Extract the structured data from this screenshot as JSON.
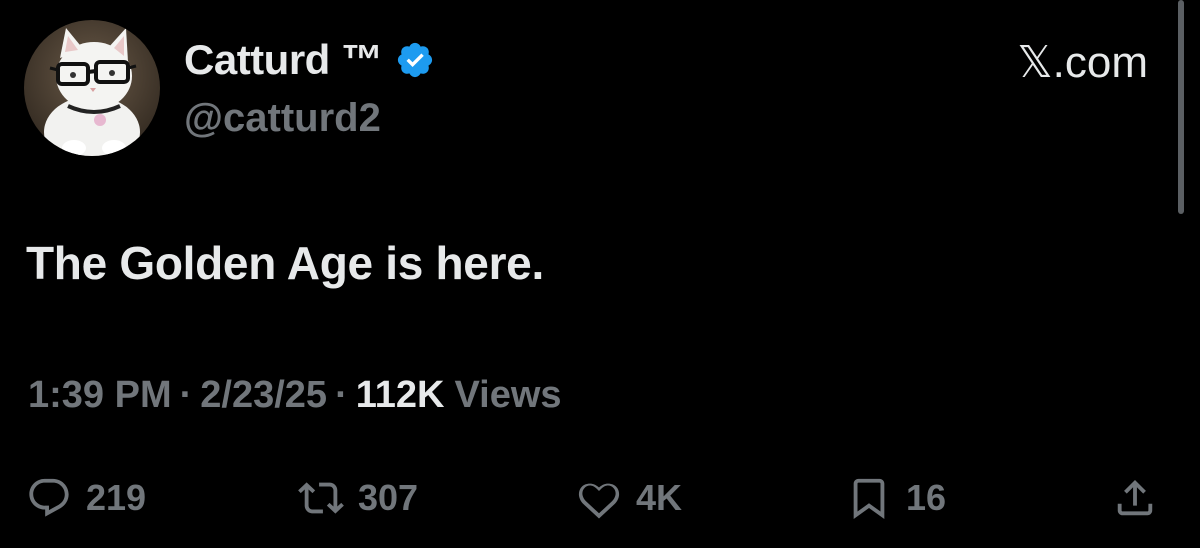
{
  "author": {
    "display_name": "Catturd ™",
    "handle": "@catturd2",
    "verified": true,
    "avatar": "cat-with-glasses-avatar"
  },
  "site": {
    "logo_text": "𝕏.com"
  },
  "tweet": {
    "text": "The Golden Age is here.",
    "time": "1:39 PM",
    "date": "2/23/25",
    "separator": "·",
    "views_count": "112K",
    "views_label": "Views"
  },
  "actions": {
    "replies": "219",
    "reposts": "307",
    "likes": "4K",
    "bookmarks": "16"
  },
  "colors": {
    "background": "#000000",
    "primary_text": "#e7e9ea",
    "secondary_text": "#71767b",
    "verified_badge": "#1d9bf0"
  }
}
